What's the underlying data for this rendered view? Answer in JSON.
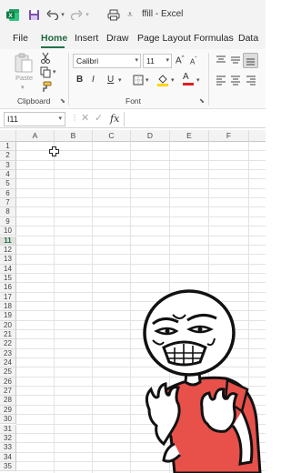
{
  "title_bar": {
    "file_name": "ffill",
    "separator": "-",
    "app_name": "Excel"
  },
  "ribbon_tabs": [
    "File",
    "Home",
    "Insert",
    "Draw",
    "Page Layout",
    "Formulas",
    "Data"
  ],
  "clipboard": {
    "paste_label": "Paste",
    "group_label": "Clipboard"
  },
  "font_group": {
    "font_name": "Calibri",
    "font_size": "11",
    "bold": "B",
    "italic": "I",
    "underline": "U",
    "grow_font": "A",
    "shrink_font": "A",
    "font_color_glyph": "A",
    "group_label": "Font"
  },
  "formula_bar": {
    "name_box": "I11",
    "fx": "fx",
    "formula": ""
  },
  "grid": {
    "columns": [
      "A",
      "B",
      "C",
      "D",
      "E",
      "F"
    ],
    "rows": [
      "1",
      "2",
      "3",
      "4",
      "5",
      "6",
      "7",
      "8",
      "9",
      "10",
      "11",
      "12",
      "13",
      "14",
      "15",
      "16",
      "17",
      "18",
      "19",
      "20",
      "21",
      "22",
      "23",
      "24",
      "25",
      "26",
      "27",
      "28",
      "29",
      "30",
      "31",
      "32",
      "33",
      "34",
      "35"
    ],
    "selected_row": "11"
  },
  "colors": {
    "accent": "#217346",
    "sticker_shirt": "#e8504a"
  },
  "icons": [
    "excel-logo-icon",
    "save-icon",
    "undo-icon",
    "redo-icon",
    "print-preview-icon",
    "customize-icon",
    "paste-icon",
    "cut-icon",
    "copy-icon",
    "format-painter-icon",
    "borders-icon",
    "fill-color-icon",
    "align-top-icon",
    "align-middle-icon",
    "align-bottom-icon",
    "align-left-icon",
    "align-center-icon",
    "align-right-icon",
    "cell-cursor-icon",
    "meme-sticker"
  ]
}
